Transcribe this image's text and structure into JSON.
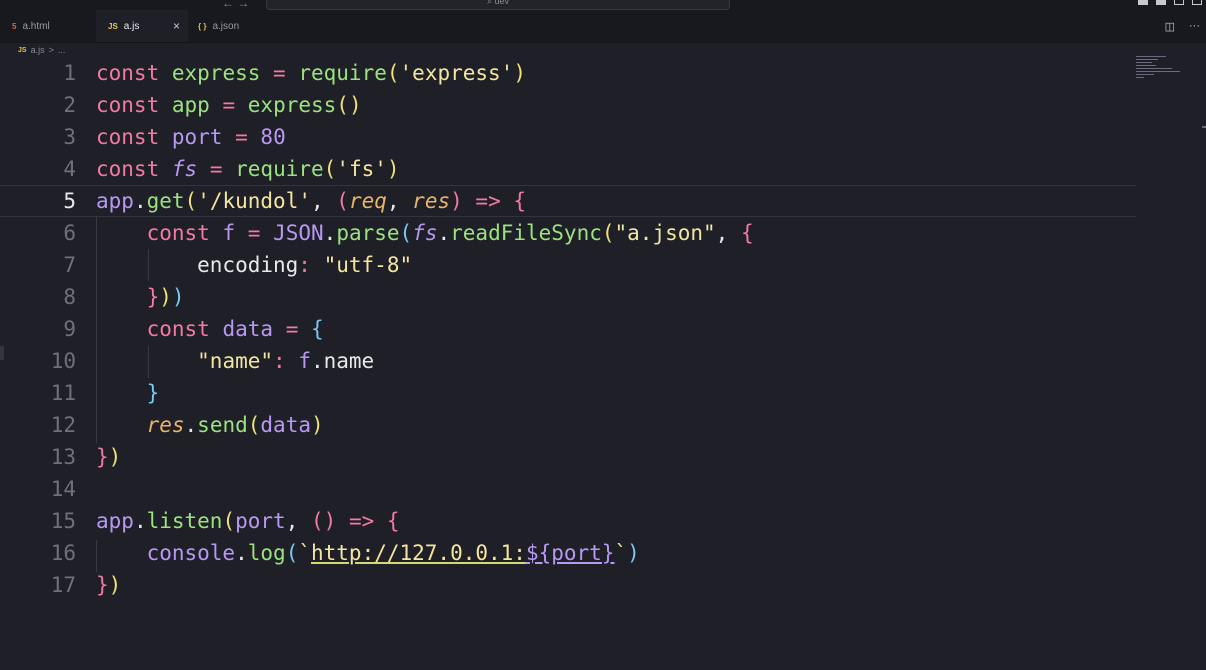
{
  "titlebar": {
    "search": "dev",
    "nav": "← →"
  },
  "tabs": [
    {
      "label": "a.html",
      "icon": "html5-icon",
      "icon_text": "5",
      "active": false
    },
    {
      "label": "a.js",
      "icon": "javascript-icon",
      "icon_text": "JS",
      "active": true,
      "close": "×"
    },
    {
      "label": "a.json",
      "icon": "json-icon",
      "icon_text": "{ }",
      "active": false
    }
  ],
  "tab_actions": {
    "split": "◫",
    "more": "···"
  },
  "breadcrumb": {
    "icon_text": "JS",
    "file": "a.js",
    "sep": ">",
    "rest": "..."
  },
  "editor": {
    "current_line": 5,
    "line_numbers": [
      "1",
      "2",
      "3",
      "4",
      "5",
      "6",
      "7",
      "8",
      "9",
      "10",
      "11",
      "12",
      "13",
      "14",
      "15",
      "16",
      "17"
    ],
    "lines": [
      "const express = require('express')",
      "const app = express()",
      "const port = 80",
      "const fs = require('fs')",
      "app.get('/kundol', (req, res) => {",
      "    const f = JSON.parse(fs.readFileSync(\"a.json\", {",
      "        encoding: \"utf-8\"",
      "    }))",
      "    const data = {",
      "        \"name\": f.name",
      "    }",
      "    res.send(data)",
      "})",
      "",
      "app.listen(port, () => {",
      "    console.log(`http://127.0.0.1:${port}`)",
      "})"
    ]
  },
  "colors": {
    "background": "#1f1f28",
    "keyword": "#f27aa3",
    "function": "#9be37f",
    "variable": "#b899f2",
    "string": "#f2e6a0",
    "parameter": "#e8b56a"
  }
}
